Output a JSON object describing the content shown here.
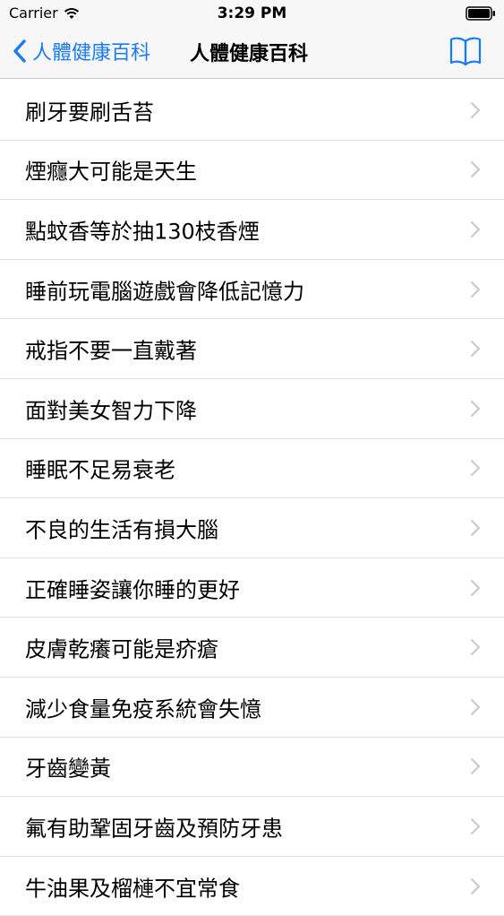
{
  "status_bar": {
    "carrier": "Carrier",
    "time": "3:29 PM",
    "wifi_icon": "wifi-icon",
    "battery_icon": "battery-icon"
  },
  "nav": {
    "back_label": "人體健康百科",
    "title": "人體健康百科",
    "back_icon": "chevron-left-icon",
    "right_icon": "book-icon",
    "accent_color": "#1a7cf5"
  },
  "list": {
    "items": [
      {
        "label": "刷牙要刷舌苔"
      },
      {
        "label": "煙癮大可能是天生"
      },
      {
        "label": "點蚊香等於抽130枝香煙"
      },
      {
        "label": "睡前玩電腦遊戲會降低記憶力"
      },
      {
        "label": "戒指不要一直戴著"
      },
      {
        "label": "面對美女智力下降"
      },
      {
        "label": "睡眠不足易衰老"
      },
      {
        "label": "不良的生活有損大腦"
      },
      {
        "label": "正確睡姿讓你睡的更好"
      },
      {
        "label": "皮膚乾癢可能是疥瘡"
      },
      {
        "label": "減少食量免疫系統會失憶"
      },
      {
        "label": "牙齒變黃"
      },
      {
        "label": "氟有助鞏固牙齒及預防牙患"
      },
      {
        "label": "牛油果及榴槤不宜常食"
      }
    ],
    "disclosure_icon": "chevron-right-icon"
  }
}
